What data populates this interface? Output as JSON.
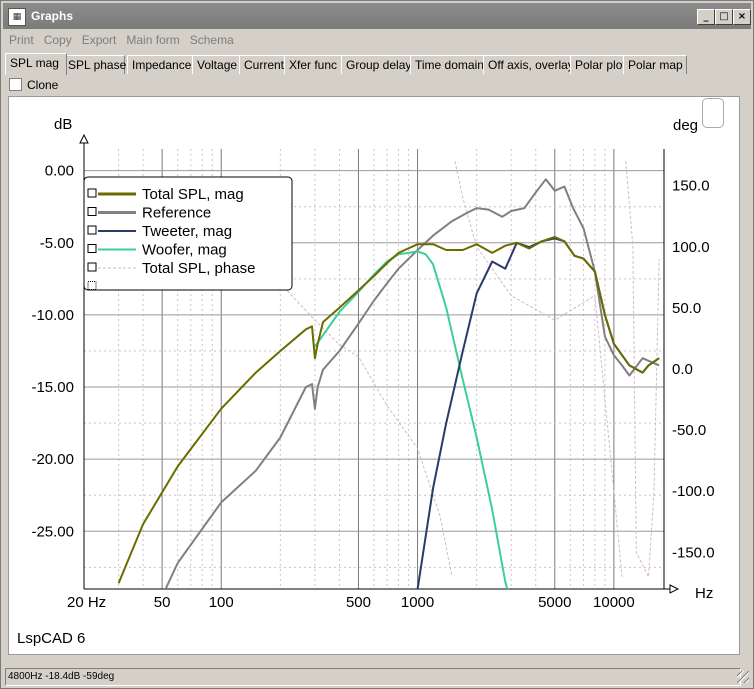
{
  "window": {
    "title": "Graphs",
    "app_icon": "graph-app-icon",
    "btn_min": "_",
    "btn_max": "□",
    "btn_close": "×"
  },
  "menu": [
    "Print",
    "Copy",
    "Export",
    "Main form",
    "Schema"
  ],
  "tabs": [
    "SPL mag",
    "SPL phase",
    "Impedance",
    "Voltage",
    "Current",
    "Xfer func",
    "Group delay",
    "Time domain",
    "Off axis, overlay",
    "Polar plot",
    "Polar map"
  ],
  "active_tab": "SPL mag",
  "clone": {
    "label": "Clone",
    "checked": false
  },
  "status": {
    "text": "4800Hz -18.4dB -59deg"
  },
  "footer_label": "LspCAD 6",
  "colors": {
    "total_spl": "#6b6b00",
    "reference": "#808080",
    "tweeter": "#2b3a66",
    "woofer": "#3ccf9a",
    "phase": "#d9b6c8"
  },
  "chart_data": {
    "type": "line",
    "x_scale": "log",
    "xlim": [
      20,
      18000
    ],
    "x_unit": "Hz",
    "x_ticks": [
      {
        "v": 20,
        "label": "20 Hz"
      },
      {
        "v": 50,
        "label": "50"
      },
      {
        "v": 100,
        "label": "100"
      },
      {
        "v": 500,
        "label": "500"
      },
      {
        "v": 1000,
        "label": "1000"
      },
      {
        "v": 5000,
        "label": "5000"
      },
      {
        "v": 10000,
        "label": "10000"
      }
    ],
    "y_left": {
      "unit": "dB",
      "range": [
        -29,
        1.5
      ],
      "ticks": [
        0,
        -5,
        -10,
        -15,
        -20,
        -25
      ],
      "labels": [
        "0.00",
        "-5.00",
        "-10.00",
        "-15.00",
        "-20.00",
        "-25.00"
      ]
    },
    "y_right": {
      "unit": "deg",
      "range": [
        -180,
        180
      ],
      "ticks": [
        150,
        100,
        50,
        0,
        -50,
        -100,
        -150
      ],
      "labels": [
        "150.0",
        "100.0",
        "50.0",
        "0.0",
        "-50.0",
        "-100.0",
        "-150.0"
      ]
    },
    "grid": true,
    "legend_position": "top-left",
    "series": [
      {
        "name": "Total SPL, mag",
        "axis": "left",
        "points": [
          [
            30,
            -28.6
          ],
          [
            40,
            -24.5
          ],
          [
            60,
            -20.5
          ],
          [
            100,
            -16.5
          ],
          [
            150,
            -14.0
          ],
          [
            200,
            -12.5
          ],
          [
            270,
            -11.0
          ],
          [
            290,
            -10.8
          ],
          [
            300,
            -13.0
          ],
          [
            310,
            -12.0
          ],
          [
            330,
            -10.5
          ],
          [
            400,
            -9.5
          ],
          [
            500,
            -8.3
          ],
          [
            600,
            -7.3
          ],
          [
            700,
            -6.4
          ],
          [
            800,
            -5.7
          ],
          [
            1000,
            -5.1
          ],
          [
            1200,
            -5.1
          ],
          [
            1400,
            -5.5
          ],
          [
            1700,
            -5.5
          ],
          [
            2000,
            -5.1
          ],
          [
            2400,
            -5.7
          ],
          [
            2800,
            -5.2
          ],
          [
            3200,
            -5.0
          ],
          [
            3700,
            -5.4
          ],
          [
            4300,
            -4.9
          ],
          [
            5000,
            -4.6
          ],
          [
            5600,
            -4.9
          ],
          [
            6300,
            -5.9
          ],
          [
            7000,
            -6.1
          ],
          [
            8000,
            -7.0
          ],
          [
            9000,
            -10.0
          ],
          [
            10000,
            -12.0
          ],
          [
            12000,
            -13.5
          ],
          [
            14000,
            -14.0
          ],
          [
            15000,
            -13.5
          ],
          [
            17000,
            -13.0
          ]
        ]
      },
      {
        "name": "Reference",
        "axis": "left",
        "points": [
          [
            30,
            -36
          ],
          [
            60,
            -27.2
          ],
          [
            100,
            -23.0
          ],
          [
            150,
            -20.8
          ],
          [
            200,
            -18.5
          ],
          [
            270,
            -15.0
          ],
          [
            290,
            -14.8
          ],
          [
            300,
            -16.5
          ],
          [
            310,
            -15.0
          ],
          [
            330,
            -13.8
          ],
          [
            400,
            -12.5
          ],
          [
            500,
            -10.6
          ],
          [
            600,
            -9.0
          ],
          [
            700,
            -7.8
          ],
          [
            800,
            -6.8
          ],
          [
            1000,
            -5.5
          ],
          [
            1200,
            -4.5
          ],
          [
            1500,
            -3.5
          ],
          [
            1800,
            -2.9
          ],
          [
            2000,
            -2.6
          ],
          [
            2300,
            -2.7
          ],
          [
            2700,
            -3.2
          ],
          [
            3000,
            -2.8
          ],
          [
            3500,
            -2.6
          ],
          [
            4000,
            -1.5
          ],
          [
            4500,
            -0.6
          ],
          [
            5000,
            -1.4
          ],
          [
            5600,
            -1.1
          ],
          [
            6200,
            -2.6
          ],
          [
            7000,
            -4.0
          ],
          [
            8000,
            -7.0
          ],
          [
            9000,
            -11.5
          ],
          [
            10000,
            -12.8
          ],
          [
            11000,
            -13.5
          ],
          [
            12000,
            -14.2
          ],
          [
            14000,
            -13.0
          ],
          [
            17000,
            -13.5
          ]
        ]
      },
      {
        "name": "Tweeter, mag",
        "axis": "left",
        "points": [
          [
            1000,
            -29
          ],
          [
            1200,
            -22
          ],
          [
            1400,
            -17.5
          ],
          [
            1700,
            -12.5
          ],
          [
            2000,
            -8.5
          ],
          [
            2400,
            -6.3
          ],
          [
            2800,
            -6.8
          ],
          [
            3200,
            -5.0
          ],
          [
            3700,
            -5.3
          ],
          [
            4300,
            -4.9
          ],
          [
            5000,
            -4.7
          ],
          [
            5600,
            -4.9
          ],
          [
            6300,
            -5.9
          ],
          [
            7000,
            -6.1
          ],
          [
            8000,
            -7.0
          ],
          [
            9000,
            -10.0
          ],
          [
            10000,
            -12.0
          ],
          [
            12000,
            -13.5
          ],
          [
            14000,
            -14.0
          ],
          [
            15000,
            -13.5
          ],
          [
            17000,
            -13.0
          ]
        ]
      },
      {
        "name": "Woofer, mag",
        "axis": "left",
        "points": [
          [
            300,
            -12.2
          ],
          [
            400,
            -9.8
          ],
          [
            500,
            -8.4
          ],
          [
            600,
            -7.2
          ],
          [
            700,
            -6.3
          ],
          [
            800,
            -5.8
          ],
          [
            900,
            -5.7
          ],
          [
            1000,
            -5.6
          ],
          [
            1100,
            -5.8
          ],
          [
            1200,
            -6.5
          ],
          [
            1400,
            -9.5
          ],
          [
            1700,
            -14.5
          ],
          [
            2000,
            -18.5
          ],
          [
            2400,
            -23.5
          ],
          [
            2800,
            -28.5
          ],
          [
            3000,
            -30
          ]
        ]
      },
      {
        "name": "Total SPL, phase",
        "axis": "right",
        "points": [
          [
            200,
            70
          ],
          [
            300,
            40
          ],
          [
            400,
            20
          ],
          [
            500,
            10
          ],
          [
            700,
            -30
          ],
          [
            1000,
            -65
          ],
          [
            1300,
            -120
          ],
          [
            1500,
            -170
          ],
          [
            1550,
            170
          ],
          [
            1700,
            140
          ],
          [
            2000,
            100
          ],
          [
            3000,
            60
          ],
          [
            5000,
            40
          ],
          [
            8000,
            60
          ],
          [
            10000,
            -100
          ],
          [
            11000,
            -170
          ],
          [
            11500,
            170
          ],
          [
            12500,
            100
          ],
          [
            13000,
            -150
          ],
          [
            15000,
            -170
          ],
          [
            16000,
            -100
          ],
          [
            17000,
            90
          ]
        ]
      }
    ]
  }
}
